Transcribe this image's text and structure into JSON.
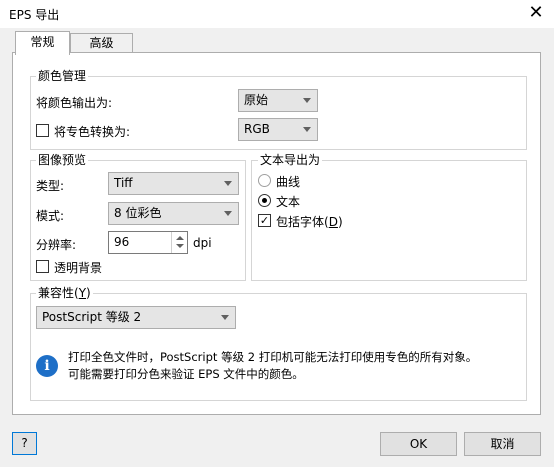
{
  "window": {
    "title": "EPS 导出",
    "close_glyph": "✕"
  },
  "tabs": [
    {
      "label": "常规",
      "active": true
    },
    {
      "label": "高级",
      "active": false
    }
  ],
  "color_management": {
    "legend": "颜色管理",
    "output_label": "将颜色输出为:",
    "output_value": "原始",
    "convert_label": "将专色转换为:",
    "convert_checked": false,
    "convert_value": "RGB"
  },
  "image_preview": {
    "legend": "图像预览",
    "type_label": "类型:",
    "type_value": "Tiff",
    "mode_label": "模式:",
    "mode_value": "8 位彩色",
    "resolution_label": "分辨率:",
    "resolution_value": "96",
    "resolution_unit": "dpi",
    "transparent_label": "透明背景",
    "transparent_checked": false
  },
  "text_export": {
    "legend": "文本导出为",
    "curves_label": "曲线",
    "text_label": "文本",
    "include_fonts_label": "包括字体(",
    "include_fonts_key": "D",
    "include_fonts_suffix": ")",
    "include_fonts_checked": true
  },
  "compatibility": {
    "legend": "兼容性(",
    "legend_key": "Y",
    "legend_suffix": ")",
    "value": "PostScript 等级 2",
    "info_line1": "打印全色文件时，PostScript 等级 2 打印机可能无法打印使用专色的所有对象。",
    "info_line2": "可能需要打印分色来验证 EPS 文件中的颜色。"
  },
  "footer": {
    "help_label": "?",
    "ok_label": "OK",
    "cancel_label": "取消"
  },
  "colors": {
    "info_blue": "#1e6fc7",
    "focus_blue": "#0078d7"
  }
}
